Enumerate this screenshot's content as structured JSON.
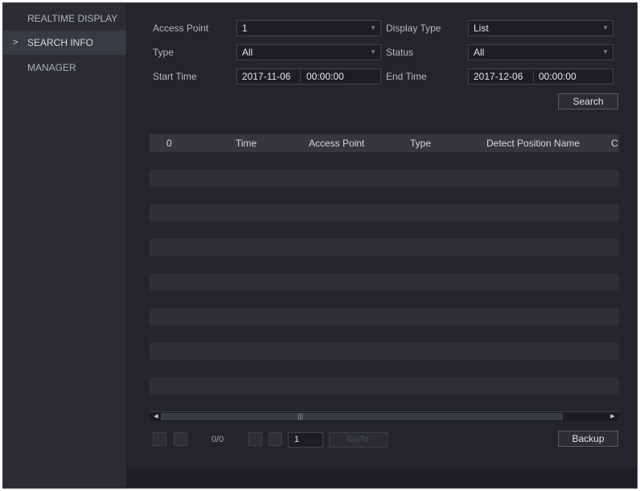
{
  "sidebar": {
    "items": [
      {
        "label": "REALTIME DISPLAY"
      },
      {
        "label": "SEARCH INFO",
        "chevron": ">"
      },
      {
        "label": "MANAGER"
      }
    ]
  },
  "filters": {
    "access_point": {
      "label": "Access Point",
      "value": "1"
    },
    "display_type": {
      "label": "Display Type",
      "value": "List"
    },
    "type": {
      "label": "Type",
      "value": "All"
    },
    "status": {
      "label": "Status",
      "value": "All"
    },
    "start_time": {
      "label": "Start Time",
      "date": "2017-11-06",
      "time": "00:00:00"
    },
    "end_time": {
      "label": "End Time",
      "date": "2017-12-06",
      "time": "00:00:00"
    },
    "search_label": "Search"
  },
  "table": {
    "columns": [
      "0",
      "Time",
      "Access Point",
      "Type",
      "Detect Position Name",
      "C"
    ],
    "row_count": 15
  },
  "scrollbar": {
    "grip": "|||"
  },
  "pagination": {
    "count": "0/0",
    "page_value": "1",
    "goto_label": "GoTo"
  },
  "actions": {
    "backup_label": "Backup"
  },
  "colors": {
    "background": "#24252b",
    "sidebar": "#2b2d33",
    "sidebar_active": "#393b42",
    "header": "#35373d"
  }
}
